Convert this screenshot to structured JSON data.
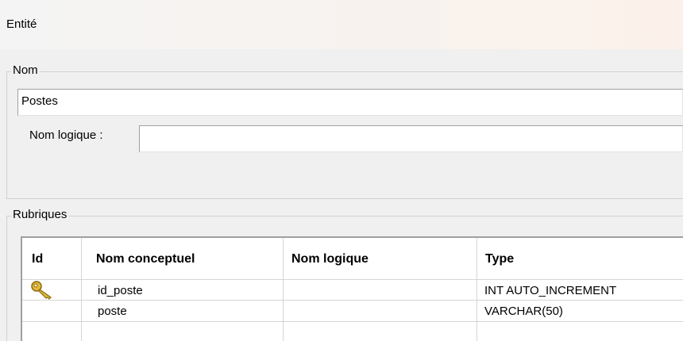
{
  "header": {
    "title": "Entité"
  },
  "nom_group": {
    "legend": "Nom",
    "name_value": "Postes",
    "logical_label": "Nom logique :",
    "logical_value": ""
  },
  "rubriques_group": {
    "legend": "Rubriques",
    "columns": [
      "Id",
      "Nom conceptuel",
      "Nom logique",
      "Type"
    ],
    "rows": [
      {
        "is_key": true,
        "nom_conceptuel": "id_poste",
        "nom_logique": "",
        "type": "INT AUTO_INCREMENT",
        "key_icon": "key-icon"
      },
      {
        "is_key": false,
        "nom_conceptuel": "poste",
        "nom_logique": "",
        "type": "VARCHAR(50)"
      }
    ]
  }
}
